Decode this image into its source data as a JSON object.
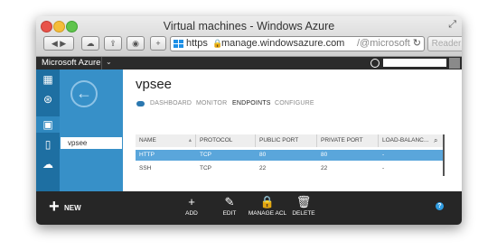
{
  "window": {
    "title": "Virtual machines - Windows Azure"
  },
  "browser": {
    "url_scheme": "https",
    "url_host": "manage.windowsazure.com",
    "url_path": "/@microsoft.o",
    "reader_label": "Reader"
  },
  "portal": {
    "brand": "Microsoft Azure"
  },
  "sidebar": {
    "selected_item": "vpsee"
  },
  "page": {
    "title": "vpsee",
    "tabs": [
      {
        "label": "DASHBOARD",
        "active": false
      },
      {
        "label": "MONITOR",
        "active": false
      },
      {
        "label": "ENDPOINTS",
        "active": true
      },
      {
        "label": "CONFIGURE",
        "active": false
      }
    ]
  },
  "table": {
    "columns": [
      "NAME",
      "PROTOCOL",
      "PUBLIC PORT",
      "PRIVATE PORT",
      "LOAD-BALANC..."
    ],
    "rows": [
      {
        "name": "HTTP",
        "protocol": "TCP",
        "public_port": "80",
        "private_port": "80",
        "load_balanced": "-",
        "selected": true
      },
      {
        "name": "SSH",
        "protocol": "TCP",
        "public_port": "22",
        "private_port": "22",
        "load_balanced": "-",
        "selected": false
      }
    ]
  },
  "commands": {
    "new_label": "NEW",
    "add_label": "ADD",
    "edit_label": "EDIT",
    "manage_acl_label": "MANAGE ACL",
    "delete_label": "DELETE",
    "help_label": "?"
  },
  "colors": {
    "accent": "#5aa6db",
    "nav": "#1e6fa2",
    "command_bar": "#262626"
  }
}
